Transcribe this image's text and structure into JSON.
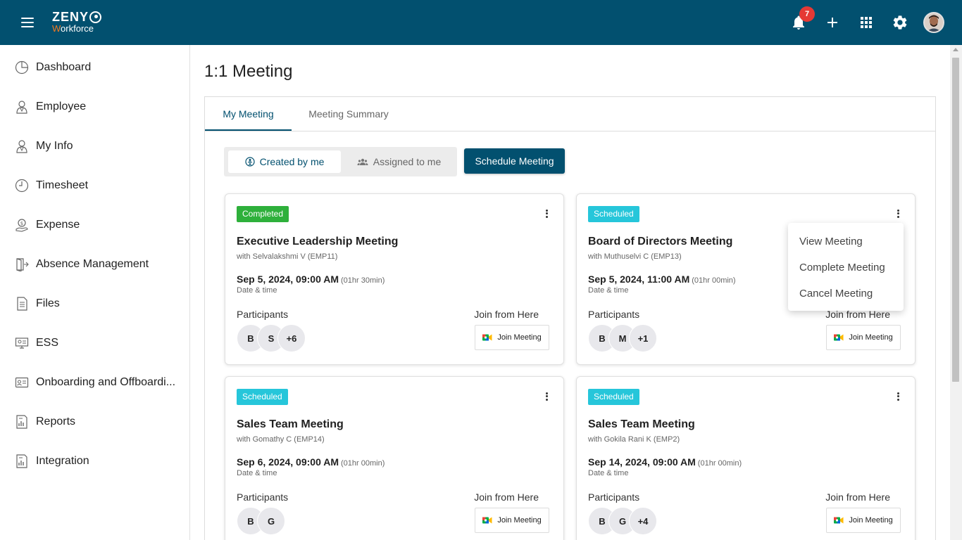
{
  "header": {
    "logo_top": "ZENY",
    "logo_bottom_first": "W",
    "logo_bottom_rest": "orkforce",
    "notification_count": "7",
    "brand_color": "#02506f",
    "icons": [
      "menu-icon",
      "bell-icon",
      "plus-icon",
      "apps-grid-icon",
      "gear-icon",
      "user-avatar"
    ]
  },
  "sidebar": {
    "items": [
      {
        "label": "Dashboard",
        "icon": "dashboard-icon"
      },
      {
        "label": "Employee",
        "icon": "employee-icon"
      },
      {
        "label": "My Info",
        "icon": "my-info-icon"
      },
      {
        "label": "Timesheet",
        "icon": "clock-icon"
      },
      {
        "label": "Expense",
        "icon": "expense-icon"
      },
      {
        "label": "Absence Management",
        "icon": "exit-door-icon"
      },
      {
        "label": "Files",
        "icon": "file-icon"
      },
      {
        "label": "ESS",
        "icon": "ess-icon"
      },
      {
        "label": "Onboarding and Offboardi...",
        "icon": "id-card-icon"
      },
      {
        "label": "Reports",
        "icon": "report-icon"
      },
      {
        "label": "Integration",
        "icon": "integration-icon"
      }
    ]
  },
  "page": {
    "title": "1:1 Meeting",
    "tabs": [
      {
        "label": "My Meeting",
        "active": true
      },
      {
        "label": "Meeting Summary",
        "active": false
      }
    ],
    "filter": {
      "created_by_me": "Created by me",
      "assigned_to_me": "Assigned to me",
      "selected": "Created by me"
    },
    "schedule_button": "Schedule Meeting"
  },
  "labels": {
    "date_time": "Date & time",
    "participants": "Participants",
    "join_from_here": "Join from Here",
    "join_meeting": "Join Meeting"
  },
  "cards": [
    {
      "status": "Completed",
      "title": "Executive Leadership Meeting",
      "with": "with Selvalakshmi V (EMP11)",
      "datetime": "Sep 5, 2024, 09:00 AM",
      "duration": "(01hr 30min)",
      "participants": [
        "B",
        "S",
        "+6"
      ]
    },
    {
      "status": "Scheduled",
      "title": "Board of Directors Meeting",
      "with": "with Muthuselvi C (EMP13)",
      "datetime": "Sep 5, 2024, 11:00 AM",
      "duration": "(01hr 00min)",
      "participants": [
        "B",
        "M",
        "+1"
      ]
    },
    {
      "status": "Scheduled",
      "title": "Sales Team Meeting",
      "with": "with Gomathy C (EMP14)",
      "datetime": "Sep 6, 2024, 09:00 AM",
      "duration": "(01hr 00min)",
      "participants": [
        "B",
        "G"
      ]
    },
    {
      "status": "Scheduled",
      "title": "Sales Team Meeting",
      "with": "with Gokila Rani K (EMP2)",
      "datetime": "Sep 14, 2024, 09:00 AM",
      "duration": "(01hr 00min)",
      "participants": [
        "B",
        "G",
        "+4"
      ]
    }
  ],
  "context_menu": {
    "items": [
      "View Meeting",
      "Complete Meeting",
      "Cancel Meeting"
    ]
  }
}
